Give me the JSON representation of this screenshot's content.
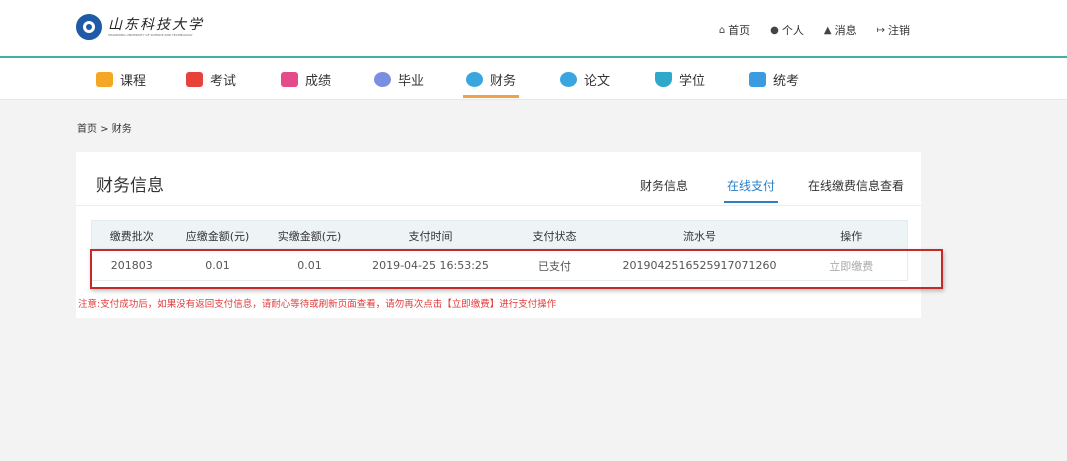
{
  "header": {
    "logo_cn": "山东科技大学",
    "logo_en": "SHANDONG UNIVERSITY OF SCIENCE AND TECHNOLOGY",
    "links": [
      {
        "icon": "home-icon",
        "label": "首页"
      },
      {
        "icon": "user-icon",
        "label": "个人"
      },
      {
        "icon": "bell-icon",
        "label": "消息"
      },
      {
        "icon": "logout-icon",
        "label": "注销"
      }
    ]
  },
  "nav": {
    "items": [
      {
        "label": "课程",
        "icon": "course-icon",
        "color": "#f5a623"
      },
      {
        "label": "考试",
        "icon": "exam-icon",
        "color": "#e8433b"
      },
      {
        "label": "成绩",
        "icon": "grade-icon",
        "color": "#e54b8c"
      },
      {
        "label": "毕业",
        "icon": "graduation-icon",
        "color": "#7a8fe0"
      },
      {
        "label": "财务",
        "icon": "finance-icon",
        "color": "#3aa6e0"
      },
      {
        "label": "论文",
        "icon": "thesis-icon",
        "color": "#3aa6e0"
      },
      {
        "label": "学位",
        "icon": "degree-icon",
        "color": "#2fa8c9"
      },
      {
        "label": "统考",
        "icon": "unified-exam-icon",
        "color": "#3a9be0"
      }
    ],
    "active": "财务"
  },
  "breadcrumb": "首页 > 财务",
  "card": {
    "title": "财务信息",
    "tabs": [
      "财务信息",
      "在线支付",
      "在线缴费信息查看"
    ],
    "active_tab": "在线支付"
  },
  "table": {
    "headers": [
      "缴费批次",
      "应缴金额(元)",
      "实缴金额(元)",
      "支付时间",
      "支付状态",
      "流水号",
      "操作"
    ],
    "rows": [
      [
        "201803",
        "0.01",
        "0.01",
        "2019-04-25 16:53:25",
        "已支付",
        "201904251652591707126​0",
        "立即缴费"
      ]
    ]
  },
  "notice": "注意:支付成功后，如果没有返回支付信息，请耐心等待或刷新页面查看，请勿再次点击【立即缴费】进行支付操作",
  "colors": {
    "accent_teal": "#3fb0a8",
    "active_tab_blue": "#2d7fc8",
    "nav_underline": "#f0a24a",
    "notice_red": "#e23a3a",
    "highlight_red": "#c42a2a"
  }
}
